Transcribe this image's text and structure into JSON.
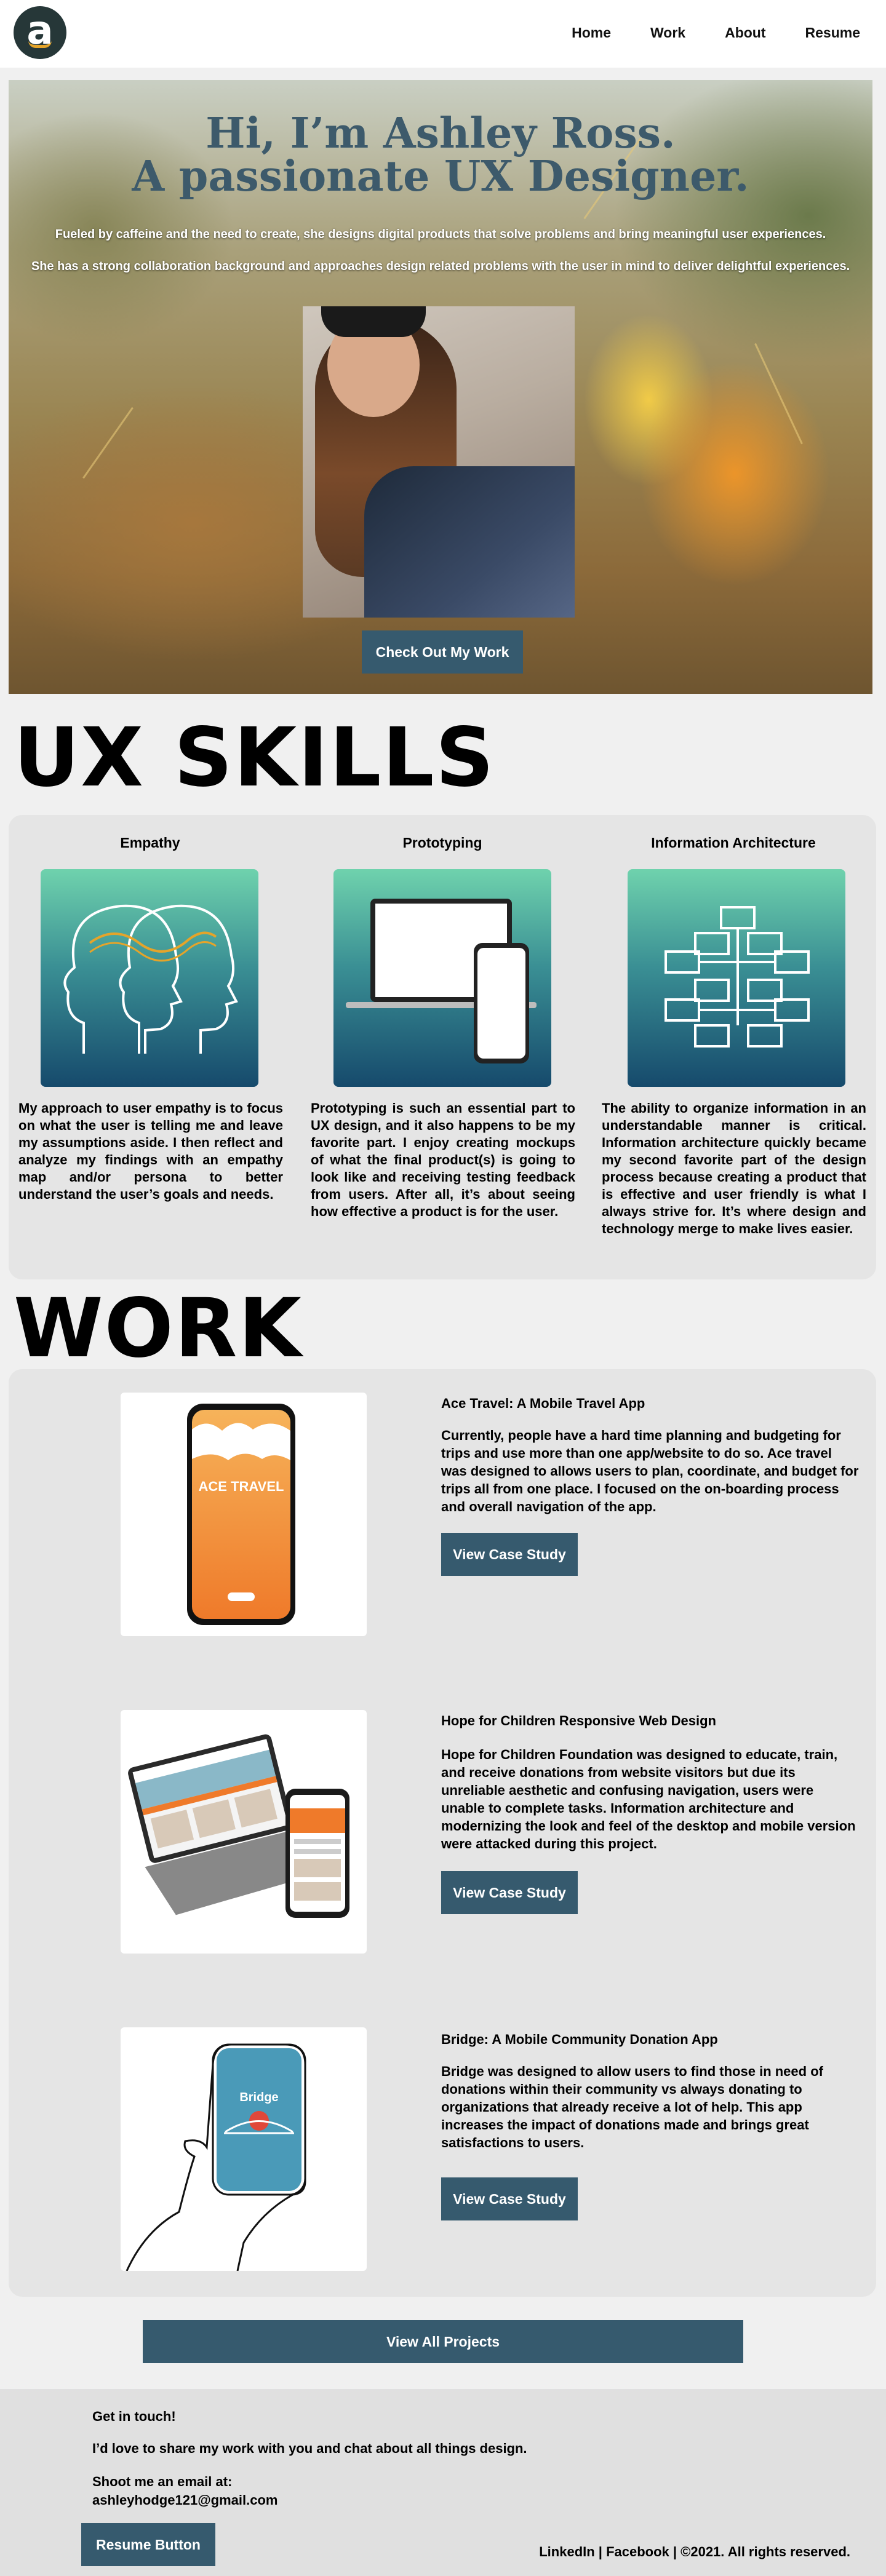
{
  "nav": {
    "logo_letter": "a",
    "items": [
      {
        "label": "Home"
      },
      {
        "label": "Work"
      },
      {
        "label": "About"
      },
      {
        "label": "Resume"
      }
    ]
  },
  "hero": {
    "title_line1": "Hi, I’m Ashley Ross.",
    "title_line2": "A passionate UX Designer.",
    "subtitle1": "Fueled by caffeine and the need to create, she designs digital products that solve problems and bring meaningful user experiences.",
    "subtitle2": "She has a strong collaboration background and approaches design related problems with the user in mind to deliver delightful experiences.",
    "cta_label": "Check Out My Work"
  },
  "skills": {
    "heading": "UX SKILLS",
    "items": [
      {
        "title": "Empathy",
        "icon": "head-profile-icon",
        "text": "My approach to user empathy is to focus on what the user is telling me and leave my assumptions aside. I then reflect and analyze my findings with an empathy map and/or persona to better understand the user’s goals and needs."
      },
      {
        "title": "Prototyping",
        "icon": "devices-icon",
        "text": "Prototyping is such an essential part to UX design, and it also happens to be my favorite part. I enjoy creating mockups of what the final product(s) is going to look like and receiving testing feedback from users. After all, it’s about seeing how effective a product is for the user."
      },
      {
        "title": "Information Architecture",
        "icon": "sitemap-icon",
        "text": "The ability to organize information in an understandable manner is critical. Information architecture quickly became my second favorite part of the design process because creating a product that is effective and user friendly is what I always strive for. It’s where design and technology merge to make lives easier."
      }
    ]
  },
  "work": {
    "heading": "WORK",
    "projects": [
      {
        "title": "Ace Travel: A Mobile Travel App",
        "image_label": "ACE TRAVEL",
        "description": "Currently, people have a hard time planning and budgeting for trips and use more than one app/website to do so. Ace travel was designed to allows users to plan, coordinate, and budget for trips all from one place. I focused on the on-boarding process and overall navigation of the app.",
        "button": "View Case Study"
      },
      {
        "title": "Hope for Children Responsive Web Design",
        "image_label": "",
        "description": "Hope for Children Foundation was designed to educate, train, and receive donations from website visitors but due its unreliable aesthetic and confusing navigation, users were unable to complete tasks. Information architecture and modernizing the look and feel of the desktop and mobile version were attacked during this project.",
        "button": "View Case Study"
      },
      {
        "title": "Bridge: A Mobile Community Donation App",
        "image_label": "Bridge",
        "description": "Bridge was designed to allow users to find those in need of donations within their community vs always donating to organizations that already receive a lot of help. This app increases the impact of donations made and brings great satisfactions to users.",
        "button": "View Case Study"
      }
    ],
    "view_all": "View All Projects"
  },
  "footer": {
    "get_in_touch": "Get in touch!",
    "share_line": "I’d love to share my work with you and chat about all things design.",
    "email_label": "Shoot me an email at:",
    "email": "ashleyhodge121@gmail.com",
    "resume_button": "Resume Button",
    "links": "LinkedIn | Facebook | ©2021. All rights reserved."
  },
  "colors": {
    "accent": "#365a6e",
    "title": "#3d5a6b",
    "panel": "#e5e5e5",
    "logo_bg": "#263738",
    "logo_swoosh": "#e5a42a"
  }
}
